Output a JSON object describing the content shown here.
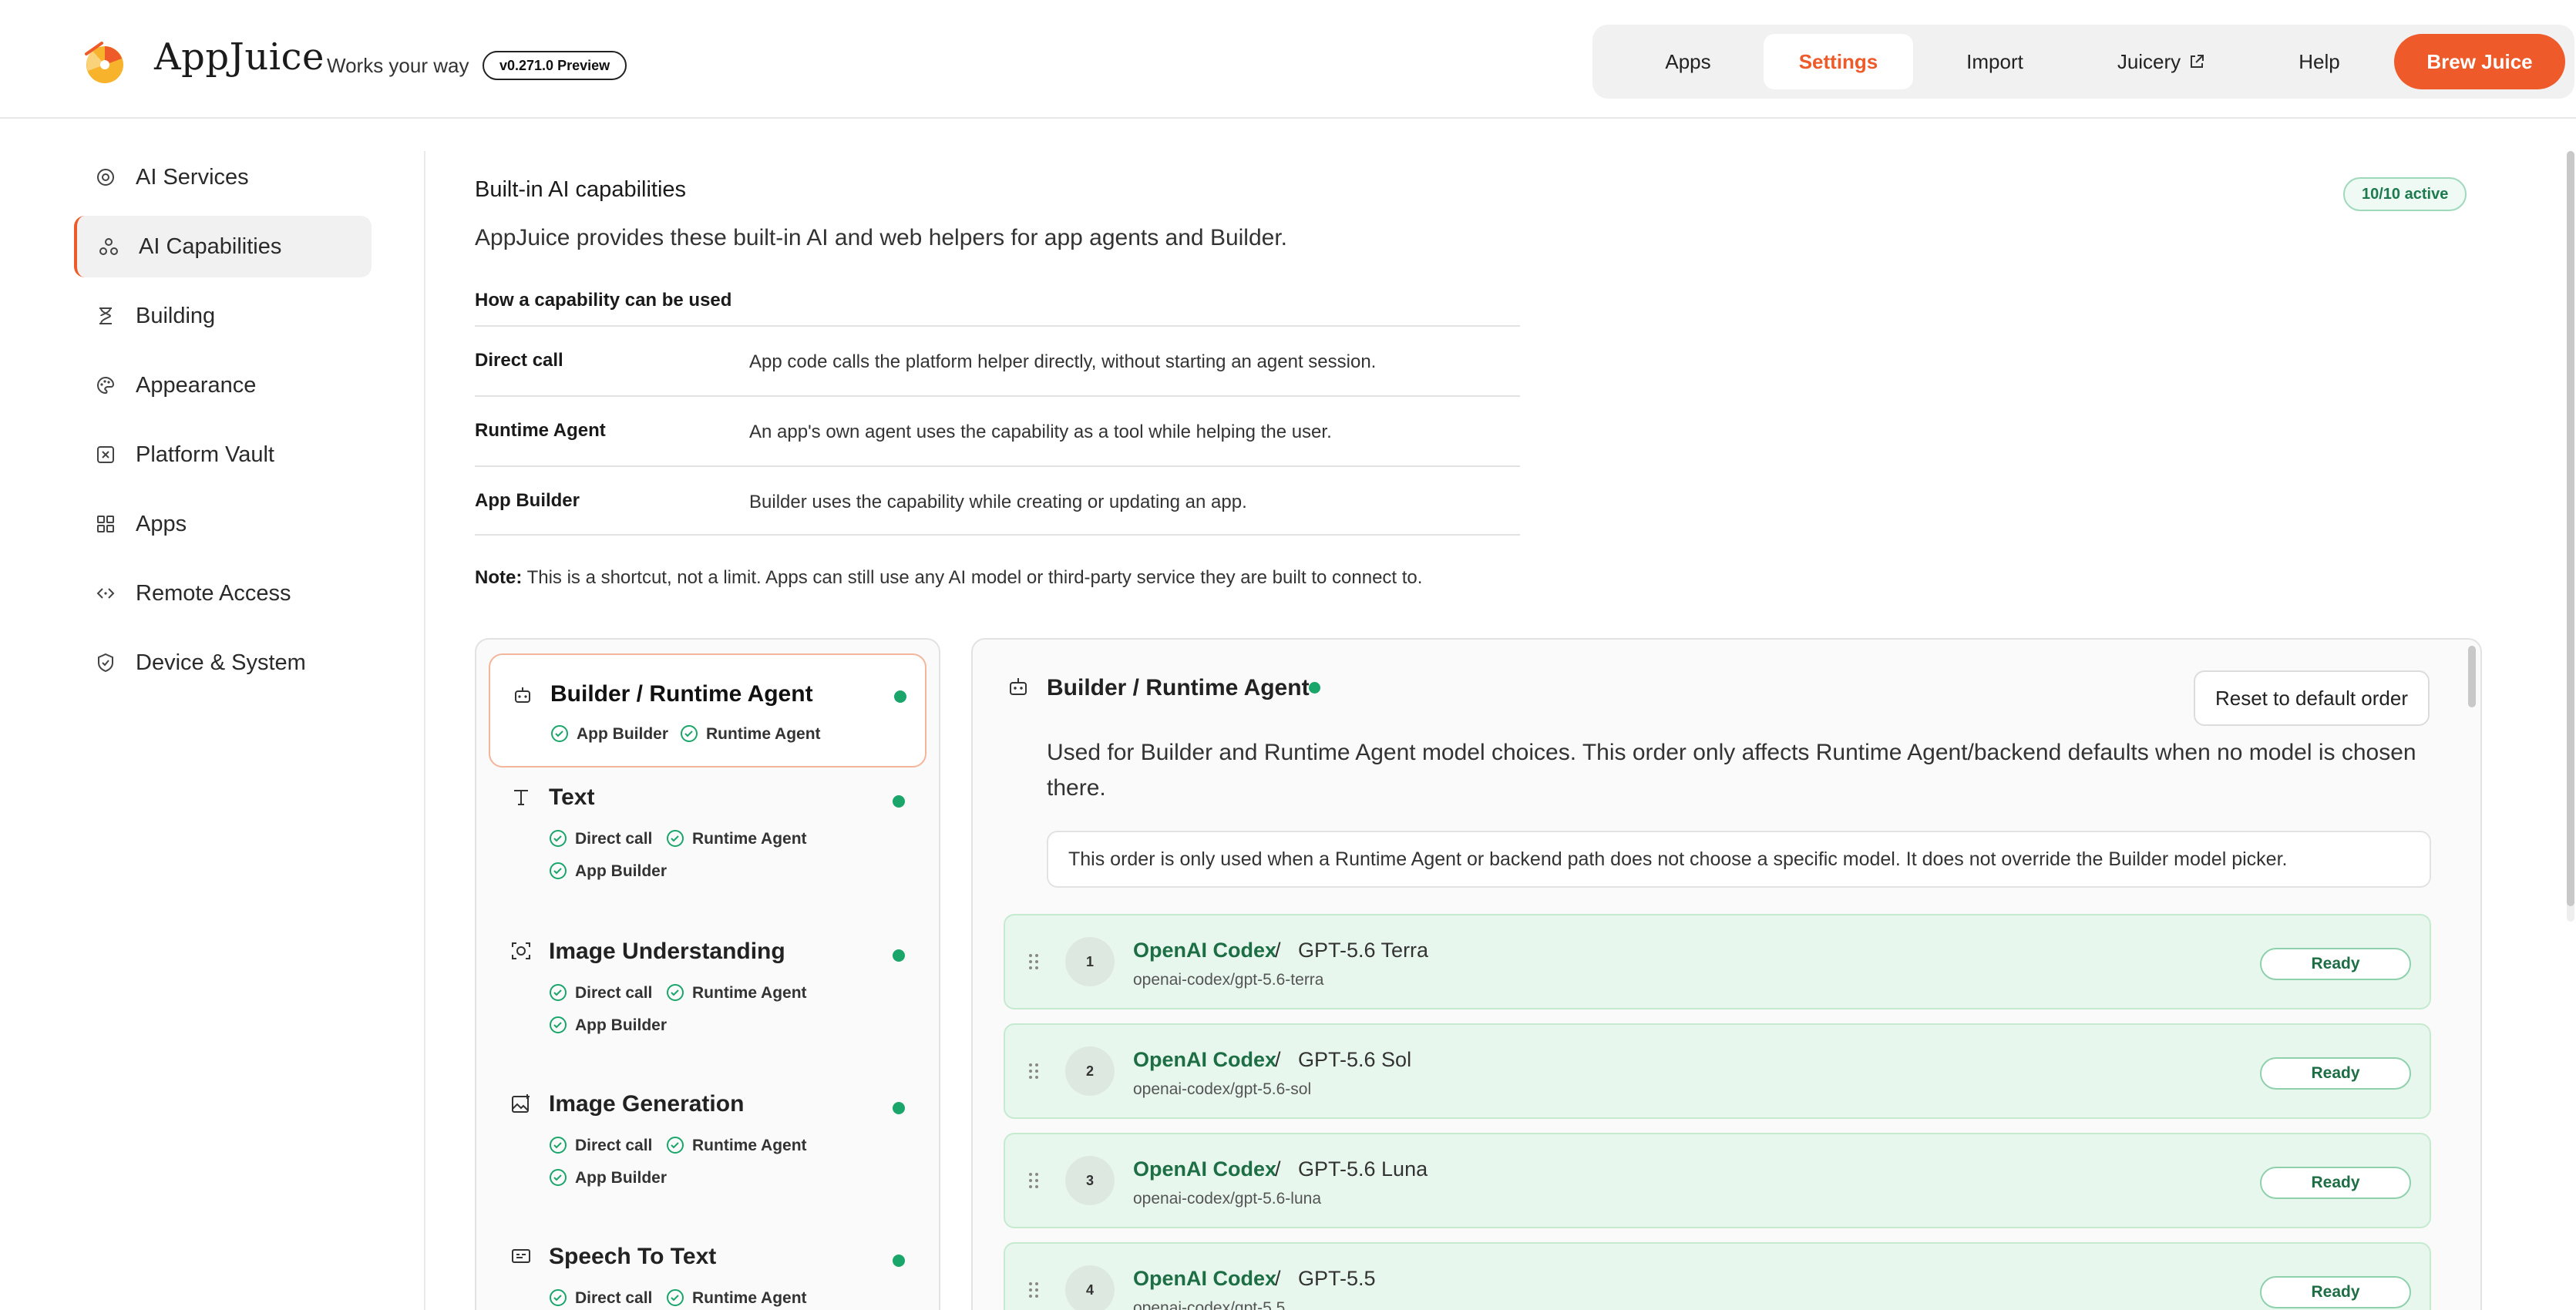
{
  "header": {
    "brand": "AppJuice",
    "tagline": "Works your way",
    "version": "v0.271.0 Preview",
    "nav": [
      "Apps",
      "Settings",
      "Import",
      "Juicery",
      "Help"
    ],
    "cta": "Brew Juice",
    "active_nav": "Settings",
    "accent": "#ee5a2a"
  },
  "sidebar": {
    "items": [
      {
        "label": "AI Services",
        "icon": "ai-services-icon"
      },
      {
        "label": "AI Capabilities",
        "icon": "capabilities-icon"
      },
      {
        "label": "Building",
        "icon": "building-icon"
      },
      {
        "label": "Appearance",
        "icon": "palette-icon"
      },
      {
        "label": "Platform Vault",
        "icon": "vault-icon"
      },
      {
        "label": "Apps",
        "icon": "grid-icon"
      },
      {
        "label": "Remote Access",
        "icon": "code-icon"
      },
      {
        "label": "Device & System",
        "icon": "shield-icon"
      }
    ],
    "active": "AI Capabilities"
  },
  "main": {
    "title": "Built-in AI capabilities",
    "badge": "10/10 active",
    "description": "AppJuice provides these built-in AI and web helpers for app agents and Builder.",
    "usage_heading": "How a capability can be used",
    "usage": [
      {
        "key": "Direct call",
        "value": "App code calls the platform helper directly, without starting an agent session."
      },
      {
        "key": "Runtime Agent",
        "value": "An app's own agent uses the capability as a tool while helping the user."
      },
      {
        "key": "App Builder",
        "value": "Builder uses the capability while creating or updating an app."
      }
    ],
    "note_label": "Note:",
    "note_text": "This is a shortcut, not a limit. Apps can still use any AI model or third-party service they are built to connect to."
  },
  "capabilities": [
    {
      "name": "Builder / Runtime Agent",
      "icon": "robot-icon",
      "tags": [
        "App Builder",
        "Runtime Agent"
      ],
      "status": "active"
    },
    {
      "name": "Text",
      "icon": "text-icon",
      "tags": [
        "Direct call",
        "Runtime Agent",
        "App Builder"
      ],
      "status": "active"
    },
    {
      "name": "Image Understanding",
      "icon": "image-scan-icon",
      "tags": [
        "Direct call",
        "Runtime Agent",
        "App Builder"
      ],
      "status": "active"
    },
    {
      "name": "Image Generation",
      "icon": "image-gen-icon",
      "tags": [
        "Direct call",
        "Runtime Agent",
        "App Builder"
      ],
      "status": "active"
    },
    {
      "name": "Speech To Text",
      "icon": "captions-icon",
      "tags": [
        "Direct call",
        "Runtime Agent"
      ],
      "status": "active"
    }
  ],
  "detail": {
    "title": "Builder / Runtime Agent",
    "reset_label": "Reset to default order",
    "description": "Used for Builder and Runtime Agent model choices. This order only affects Runtime Agent/backend defaults when no model is chosen there.",
    "info": "This order is only used when a Runtime Agent or backend path does not choose a specific model. It does not override the Builder model picker.",
    "models": [
      {
        "rank": "1",
        "provider": "OpenAI Codex",
        "name": "GPT-5.6 Terra",
        "id": "openai-codex/gpt-5.6-terra",
        "status": "Ready"
      },
      {
        "rank": "2",
        "provider": "OpenAI Codex",
        "name": "GPT-5.6 Sol",
        "id": "openai-codex/gpt-5.6-sol",
        "status": "Ready"
      },
      {
        "rank": "3",
        "provider": "OpenAI Codex",
        "name": "GPT-5.6 Luna",
        "id": "openai-codex/gpt-5.6-luna",
        "status": "Ready"
      },
      {
        "rank": "4",
        "provider": "OpenAI Codex",
        "name": "GPT-5.5",
        "id": "openai-codex/gpt-5.5",
        "status": "Ready"
      }
    ]
  }
}
